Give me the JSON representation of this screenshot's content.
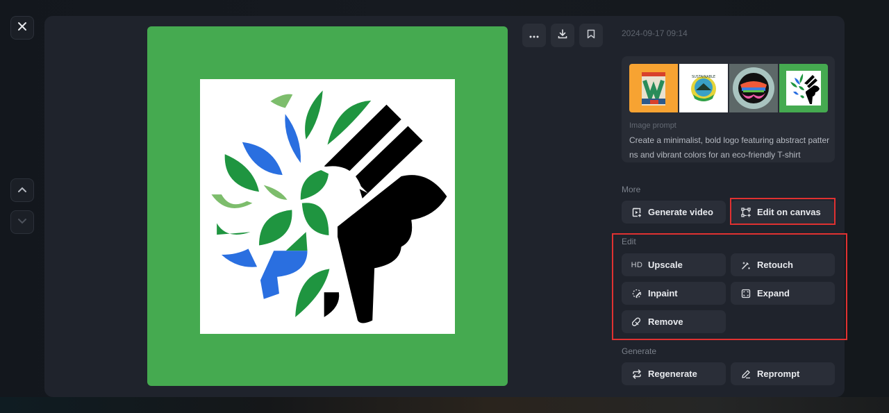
{
  "window": {
    "close_label": "Close",
    "nav_up_label": "Previous",
    "nav_down_label": "Next"
  },
  "image": {
    "description": "Eco-friendly logo: green and blue leaves with black hand holding a brush",
    "frame_color": "#45aa50"
  },
  "toolbar": {
    "more_icon": "more-horizontal-icon",
    "download_icon": "download-icon",
    "bookmark_icon": "bookmark-icon"
  },
  "details": {
    "timestamp": "2024-09-17 09:14",
    "thumbnails": [
      {
        "name": "thumbnail-orange-w",
        "bg": "#f7a332"
      },
      {
        "name": "thumbnail-globe-emblem",
        "bg": "#ffffff"
      },
      {
        "name": "thumbnail-colorful-circle",
        "bg": "#5d6868"
      },
      {
        "name": "thumbnail-leaf-hand",
        "bg": "#45aa50"
      }
    ],
    "prompt_label": "Image prompt",
    "prompt_text": "Create a minimalist, bold logo featuring abstract patterns and vibrant colors for an eco-friendly T-shirt"
  },
  "sections": {
    "more": {
      "label": "More",
      "buttons": [
        {
          "label": "Generate video",
          "icon": "video-plus-icon"
        },
        {
          "label": "Edit on canvas",
          "icon": "canvas-edit-icon",
          "highlighted": true
        }
      ]
    },
    "edit": {
      "label": "Edit",
      "highlighted": true,
      "buttons": [
        {
          "label": "Upscale",
          "icon_text": "HD",
          "icon": "hd-icon"
        },
        {
          "label": "Retouch",
          "icon": "magic-wand-icon"
        },
        {
          "label": "Inpaint",
          "icon": "inpaint-brush-icon"
        },
        {
          "label": "Expand",
          "icon": "expand-icon"
        },
        {
          "label": "Remove",
          "icon": "eraser-icon"
        }
      ]
    },
    "generate": {
      "label": "Generate",
      "buttons": [
        {
          "label": "Regenerate",
          "icon": "regenerate-icon"
        },
        {
          "label": "Reprompt",
          "icon": "pencil-icon"
        }
      ]
    }
  },
  "colors": {
    "highlight": "#e03131",
    "panel_bg": "#1f232c",
    "button_bg": "#2a2e38"
  }
}
